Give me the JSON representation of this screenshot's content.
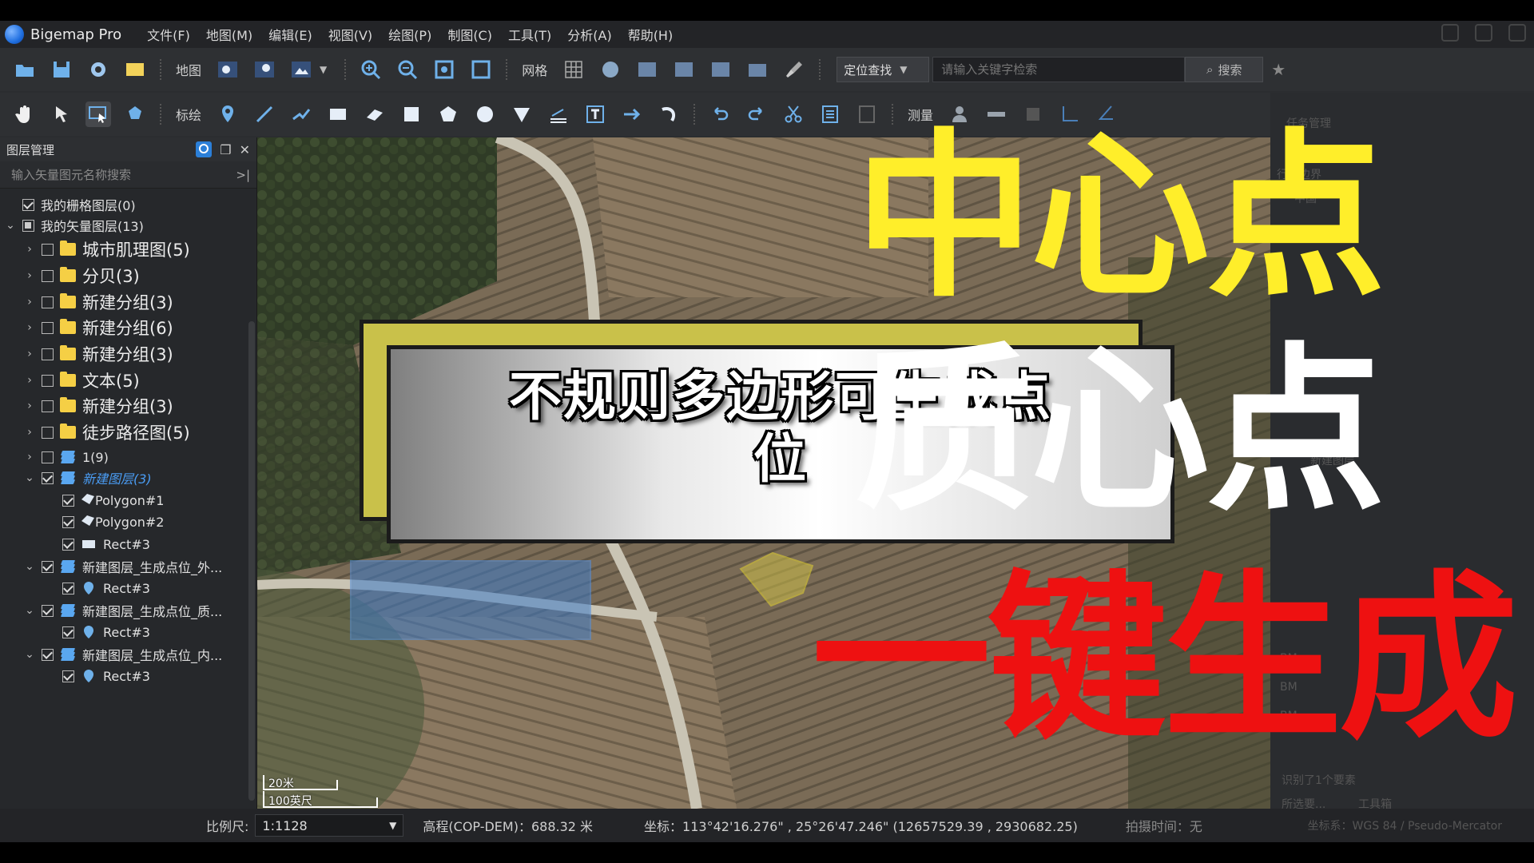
{
  "app": {
    "name": "Bigemap Pro",
    "menus": [
      "文件(F)",
      "地图(M)",
      "编辑(E)",
      "视图(V)",
      "绘图(P)",
      "制图(C)",
      "工具(T)",
      "分析(A)",
      "帮助(H)"
    ]
  },
  "toolbar1": {
    "map_label": "地图",
    "grid_label": "网格",
    "locate_label": "定位查找",
    "search_placeholder": "请输入关键字检索",
    "search_button": "搜索"
  },
  "toolbar2": {
    "mark_label": "标绘",
    "measure_label": "测量"
  },
  "panel": {
    "title": "图层管理",
    "search_placeholder": "输入矢量图元名称搜索",
    "tree": [
      {
        "label": "我的栅格图层(0)",
        "level": 0,
        "arrow": "",
        "check": "on",
        "icon": "none",
        "style": "lbl"
      },
      {
        "label": "我的矢量图层(13)",
        "level": 0,
        "arrow": "v",
        "check": "partial",
        "icon": "none",
        "style": "lbl"
      },
      {
        "label": "城市肌理图(5)",
        "level": 1,
        "arrow": ">",
        "check": "off",
        "icon": "folder",
        "style": "big"
      },
      {
        "label": "分贝(3)",
        "level": 1,
        "arrow": ">",
        "check": "off",
        "icon": "folder",
        "style": "big"
      },
      {
        "label": "新建分组(3)",
        "level": 1,
        "arrow": ">",
        "check": "off",
        "icon": "folder",
        "style": "big"
      },
      {
        "label": "新建分组(6)",
        "level": 1,
        "arrow": ">",
        "check": "off",
        "icon": "folder",
        "style": "big"
      },
      {
        "label": "新建分组(3)",
        "level": 1,
        "arrow": ">",
        "check": "off",
        "icon": "folder",
        "style": "big"
      },
      {
        "label": "文本(5)",
        "level": 1,
        "arrow": ">",
        "check": "off",
        "icon": "folder",
        "style": "big"
      },
      {
        "label": "新建分组(3)",
        "level": 1,
        "arrow": ">",
        "check": "off",
        "icon": "folder",
        "style": "big"
      },
      {
        "label": "徒步路径图(5)",
        "level": 1,
        "arrow": ">",
        "check": "off",
        "icon": "folder",
        "style": "big"
      },
      {
        "label": "1(9)",
        "level": 1,
        "arrow": ">",
        "check": "off",
        "icon": "layers",
        "style": "lbl"
      },
      {
        "label": "新建图层(3)",
        "level": 1,
        "arrow": "v",
        "check": "on",
        "icon": "layers",
        "style": "accent"
      },
      {
        "label": "Polygon#1",
        "level": 2,
        "arrow": "",
        "check": "on",
        "icon": "polygon",
        "style": "lbl"
      },
      {
        "label": "Polygon#2",
        "level": 2,
        "arrow": "",
        "check": "on",
        "icon": "polygon",
        "style": "lbl"
      },
      {
        "label": "Rect#3",
        "level": 2,
        "arrow": "",
        "check": "on",
        "icon": "rect",
        "style": "lbl"
      },
      {
        "label": "新建图层_生成点位_外...",
        "level": 1,
        "arrow": "v",
        "check": "on",
        "icon": "layers",
        "style": "lbl"
      },
      {
        "label": "Rect#3",
        "level": 2,
        "arrow": "",
        "check": "on",
        "icon": "pin",
        "style": "lbl"
      },
      {
        "label": "新建图层_生成点位_质...",
        "level": 1,
        "arrow": "v",
        "check": "on",
        "icon": "layers",
        "style": "lbl"
      },
      {
        "label": "Rect#3",
        "level": 2,
        "arrow": "",
        "check": "on",
        "icon": "pin",
        "style": "lbl"
      },
      {
        "label": "新建图层_生成点位_内...",
        "level": 1,
        "arrow": "v",
        "check": "on",
        "icon": "layers",
        "style": "lbl"
      },
      {
        "label": "Rect#3",
        "level": 2,
        "arrow": "",
        "check": "on",
        "icon": "pin",
        "style": "lbl"
      }
    ]
  },
  "map": {
    "scalebar_top": "20米",
    "scalebar_bottom": "100英尺"
  },
  "status": {
    "scale_label": "比例尺:",
    "scale_value": "1:1128",
    "elevation": "高程(COP-DEM)：688.32 米",
    "coordinates": "坐标：113°42'16.276\" , 25°26'47.246\"   (12657529.39 , 2930682.25)",
    "capture_time": "拍摄时间：无",
    "crs": "坐标系：WGS 84 / Pseudo-Mercator"
  },
  "right_panel": {
    "admin_label": "行政边界",
    "country": "中国",
    "layer_tag": "新建图层",
    "bm_labels": [
      "BM",
      "BM",
      "BM"
    ],
    "result_text": "识别了1个要素",
    "footer_left": "所选要...",
    "footer_right": "工具箱",
    "task_label": "任务管理"
  },
  "overlay": {
    "banner_line1": "不规则多边形可生成点",
    "banner_line2": "位",
    "heading1": "中心点",
    "heading2": "质心点",
    "heading3": "一键生成"
  },
  "colors": {
    "heading1": "#ffee2a",
    "heading2": "#ffffff",
    "heading3": "#ee1111",
    "accent": "#4a9df5",
    "folder": "#f5cf45"
  }
}
